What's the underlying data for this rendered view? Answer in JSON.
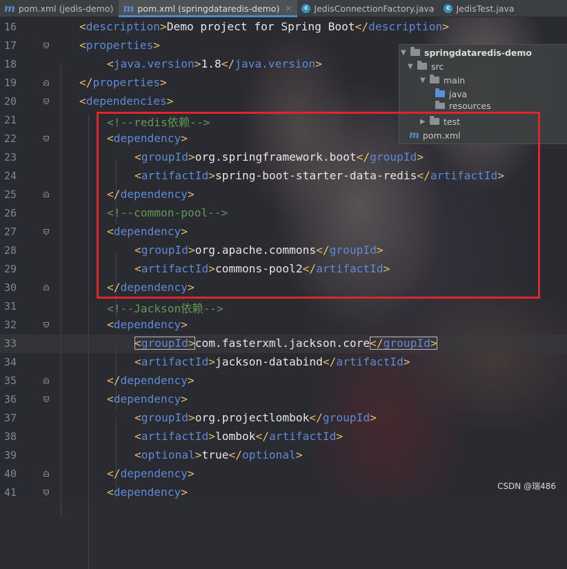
{
  "tabs": [
    {
      "icon": "maven-icon",
      "label": "pom.xml (jedis-demo)",
      "active": false
    },
    {
      "icon": "maven-icon",
      "label": "pom.xml (springdataredis-demo)",
      "active": true
    },
    {
      "icon": "class-icon",
      "label": "JedisConnectionFactory.java",
      "active": false
    },
    {
      "icon": "class-icon",
      "label": "JedisTest.java",
      "active": false
    }
  ],
  "tab_close_glyph": "×",
  "editor": {
    "current_line": "33",
    "lines": [
      {
        "n": "16",
        "text": "<description>Demo project for Spring Boot</description>"
      },
      {
        "n": "17",
        "text": "<properties>"
      },
      {
        "n": "18",
        "text": "<java.version>1.8</java.version>"
      },
      {
        "n": "19",
        "text": "</properties>"
      },
      {
        "n": "20",
        "text": "<dependencies>"
      },
      {
        "n": "21",
        "text": "<!--redis依赖-->"
      },
      {
        "n": "22",
        "text": "<dependency>"
      },
      {
        "n": "23",
        "text": "<groupId>org.springframework.boot</groupId>"
      },
      {
        "n": "24",
        "text": "<artifactId>spring-boot-starter-data-redis</artifactId>"
      },
      {
        "n": "25",
        "text": "</dependency>"
      },
      {
        "n": "26",
        "text": "<!--common-pool-->"
      },
      {
        "n": "27",
        "text": "<dependency>"
      },
      {
        "n": "28",
        "text": "<groupId>org.apache.commons</groupId>"
      },
      {
        "n": "29",
        "text": "<artifactId>commons-pool2</artifactId>"
      },
      {
        "n": "30",
        "text": "</dependency>"
      },
      {
        "n": "31",
        "text": "<!--Jackson依赖-->"
      },
      {
        "n": "32",
        "text": "<dependency>"
      },
      {
        "n": "33",
        "text": "<groupId>com.fasterxml.jackson.core</groupId>"
      },
      {
        "n": "34",
        "text": "<artifactId>jackson-databind</artifactId>"
      },
      {
        "n": "35",
        "text": "</dependency>"
      },
      {
        "n": "36",
        "text": "<dependency>"
      },
      {
        "n": "37",
        "text": "<groupId>org.projectlombok</groupId>"
      },
      {
        "n": "38",
        "text": "<artifactId>lombok</artifactId>"
      },
      {
        "n": "39",
        "text": "<optional>true</optional>"
      },
      {
        "n": "40",
        "text": "</dependency>"
      },
      {
        "n": "41",
        "text": "<dependency>"
      }
    ]
  },
  "project_tree": {
    "root": "springdataredis-demo",
    "src": "src",
    "main": "main",
    "java": "java",
    "resources": "resources",
    "test": "test",
    "pom": "pom.xml"
  },
  "colors": {
    "tag_bracket": "#e8bf6a",
    "tag_name": "#5d8bd6",
    "comment": "#629755",
    "highlight_box": "#e0262b"
  },
  "watermark": "CSDN @瑞486"
}
